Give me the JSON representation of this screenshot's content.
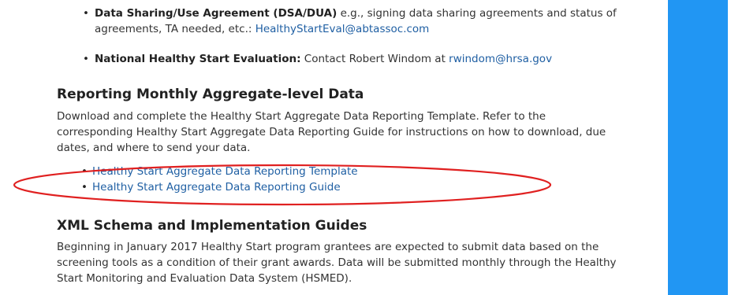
{
  "colors": {
    "link": "#1f5fa3",
    "sidebar": "#2196f3",
    "annotation": "#e02020"
  },
  "contacts": [
    {
      "label": "Data Sharing/Use Agreement (DSA/DUA)",
      "text_before": " e.g., signing data sharing agreements and status of agreements, TA needed, etc.: ",
      "link": "HealthyStartEval@abtassoc.com"
    },
    {
      "label": "National Healthy Start Evaluation:",
      "text_before": " Contact Robert Windom at ",
      "link": "rwindom@hrsa.gov"
    }
  ],
  "reporting": {
    "heading": "Reporting Monthly Aggregate-level Data",
    "body": "Download and complete the Healthy Start Aggregate Data Reporting Template. Refer to the corresponding Healthy Start Aggregate Data Reporting Guide for instructions on how to download, due dates, and where to send your data.",
    "links": [
      "Healthy Start Aggregate Data Reporting Template",
      "Healthy Start Aggregate Data Reporting Guide"
    ]
  },
  "xml": {
    "heading": "XML Schema and Implementation Guides",
    "body": "Beginning in January 2017 Healthy Start program grantees are expected to submit data based on the screening tools as a condition of their grant awards. Data will be submitted monthly through the Healthy Start Monitoring and Evaluation Data System (HSMED)."
  }
}
